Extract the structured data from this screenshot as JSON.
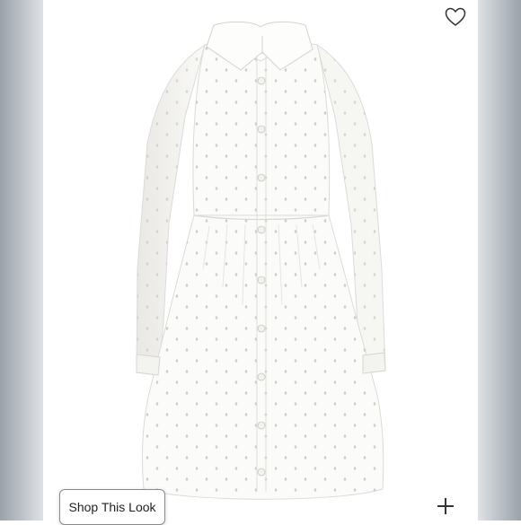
{
  "shop_look": {
    "label": "Shop This Look"
  },
  "icons": {
    "favorite": "heart-outline-icon",
    "add": "plus-icon"
  },
  "product": {
    "garment_color": "#fbfbf9"
  }
}
